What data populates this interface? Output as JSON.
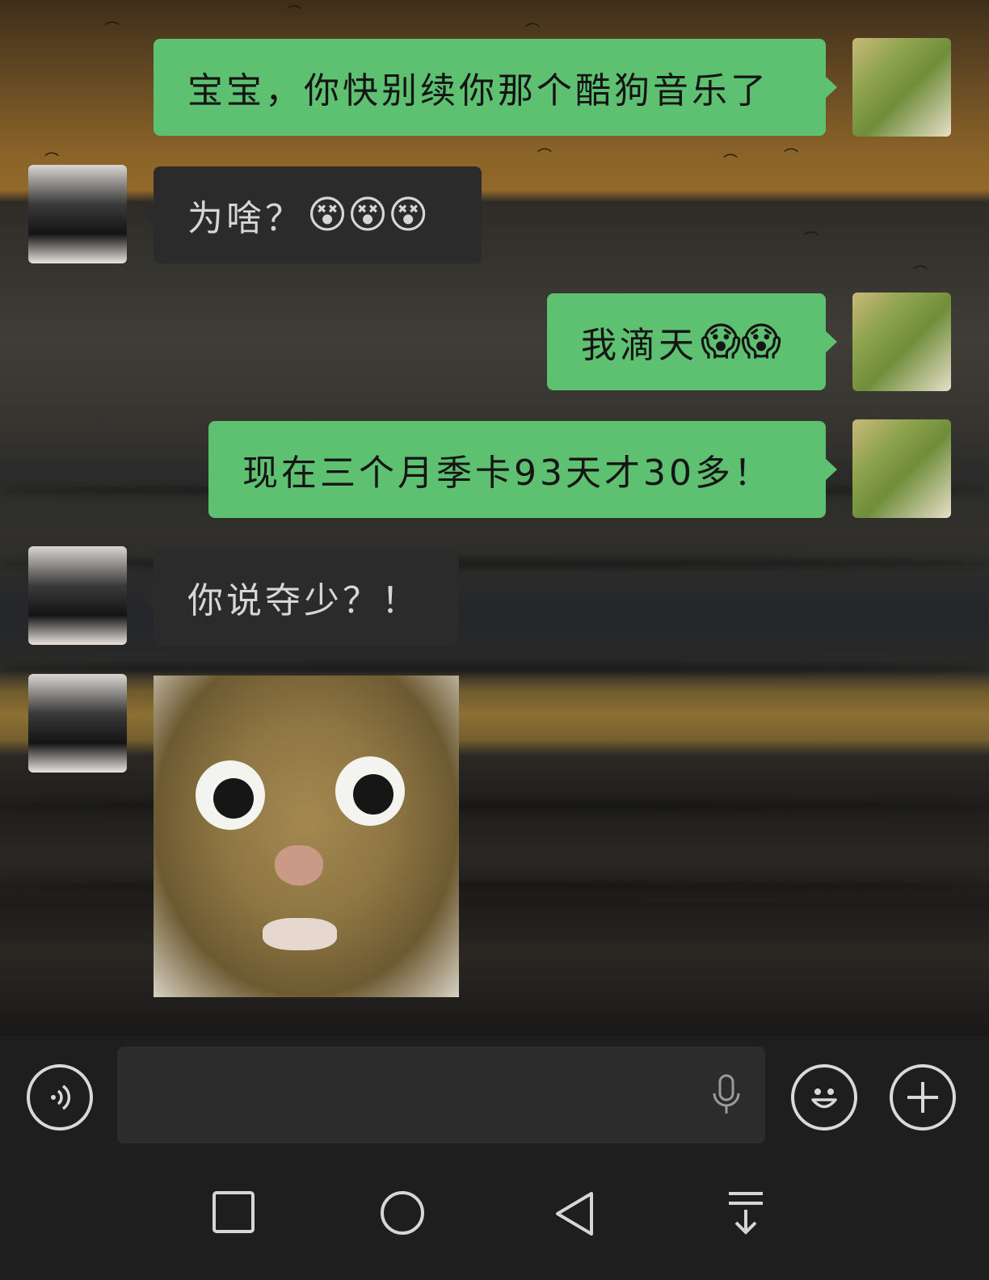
{
  "messages": [
    {
      "sender": "me",
      "text": "宝宝，你快别续你那个酷狗音乐了",
      "emoji": ""
    },
    {
      "sender": "friend",
      "text": "为啥？",
      "emoji": "😵😵😵"
    },
    {
      "sender": "me",
      "text": "我滴天",
      "emoji": "😱😱"
    },
    {
      "sender": "me",
      "text": "现在三个月季卡93天才30多！",
      "emoji": ""
    },
    {
      "sender": "friend",
      "text": "你说夺少？！",
      "emoji": ""
    },
    {
      "sender": "friend",
      "type": "sticker",
      "sticker": "surprised-cat-sticker"
    }
  ],
  "input_bar": {
    "voice_icon": "voice-mode-icon",
    "text_value": "",
    "mic_icon": "microphone-icon",
    "emoji_icon": "emoji-icon",
    "plus_icon": "plus-icon"
  },
  "nav_bar": {
    "recents_icon": "square-icon",
    "home_icon": "circle-icon",
    "back_icon": "triangle-back-icon",
    "notification_icon": "pull-down-icon"
  },
  "colors": {
    "my_bubble": "#5ec071",
    "their_bubble": "#2b2b2b",
    "bar_bg": "#1e1e1e"
  }
}
